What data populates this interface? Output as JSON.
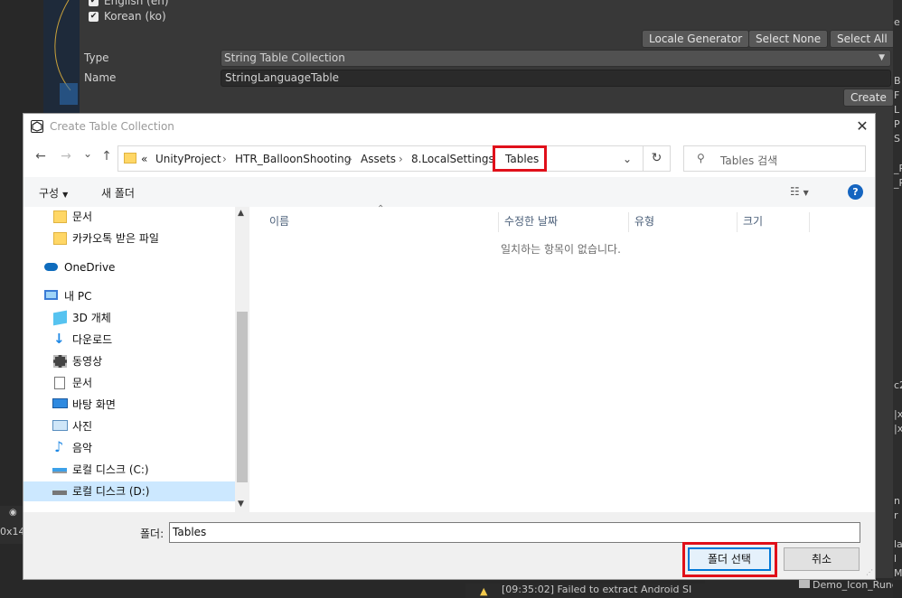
{
  "unity": {
    "locales": [
      "English (en)",
      "Korean (ko)"
    ],
    "buttons": {
      "locale_generator": "Locale Generator",
      "select_none": "Select None",
      "select_all": "Select All",
      "create": "Create"
    },
    "type_label": "Type",
    "type_value": "String Table Collection",
    "name_label": "Name",
    "name_value": "StringLanguageTable",
    "console_text": "[09:35:02] Failed to extract Android SI",
    "project_item": "Demo_Icon_Rune",
    "game_tab": "0x14",
    "right_panel_letters": [
      "e",
      "B",
      "F",
      "L",
      "P",
      "S",
      "_P",
      "_P",
      "c2",
      "|x",
      "|x",
      "n",
      "r",
      "la",
      "l",
      "M"
    ]
  },
  "dialog": {
    "title": "Create Table Collection",
    "close": "✕",
    "nav": {
      "back": "←",
      "forward": "→",
      "recent": "⌄",
      "up": "↑"
    },
    "breadcrumb": {
      "overflow": "«",
      "items": [
        "UnityProject",
        "HTR_BalloonShooting",
        "Assets",
        "8.LocalSettings",
        "Tables"
      ],
      "sep": "›"
    },
    "search_placeholder": "Tables 검색",
    "commands": {
      "organize": "구성",
      "new_folder": "새 폴더"
    },
    "nav_items": [
      {
        "label": "문서",
        "icon": "folder"
      },
      {
        "label": "카카오톡 받은 파일",
        "icon": "folder"
      },
      {
        "label": "OneDrive",
        "icon": "cloud"
      },
      {
        "label": "내 PC",
        "icon": "pc"
      },
      {
        "label": "3D 개체",
        "icon": "cube"
      },
      {
        "label": "다운로드",
        "icon": "download"
      },
      {
        "label": "동영상",
        "icon": "video"
      },
      {
        "label": "문서",
        "icon": "document"
      },
      {
        "label": "바탕 화면",
        "icon": "desktop"
      },
      {
        "label": "사진",
        "icon": "picture"
      },
      {
        "label": "음악",
        "icon": "music"
      },
      {
        "label": "로컬 디스크 (C:)",
        "icon": "drive"
      },
      {
        "label": "로컬 디스크 (D:)",
        "icon": "drive"
      }
    ],
    "columns": [
      "이름",
      "수정한 날짜",
      "유형",
      "크기"
    ],
    "empty_message": "일치하는 항목이 없습니다.",
    "folder_label": "폴더:",
    "folder_value": "Tables",
    "select_folder": "폴더 선택",
    "cancel": "취소",
    "highlight_color": "#e0101a",
    "accent": "#0078d7"
  }
}
